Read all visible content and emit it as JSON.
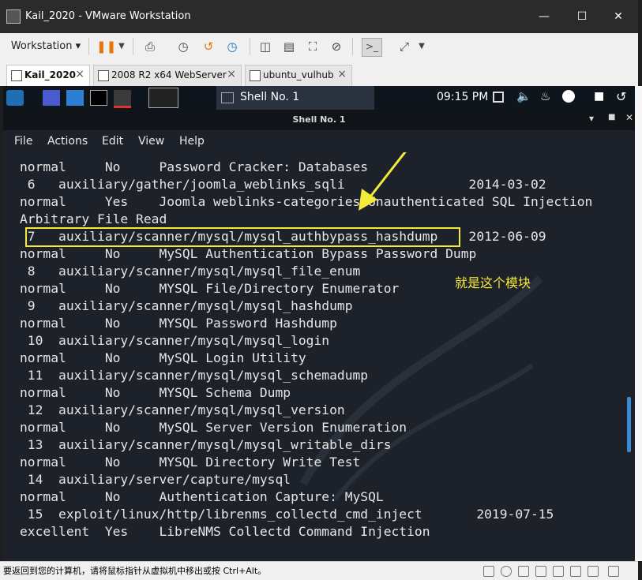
{
  "window": {
    "title": "Kail_2020 - VMware Workstation"
  },
  "toolbar": {
    "workstation_label": "Workstation"
  },
  "tabs": [
    {
      "label": "Kail_2020"
    },
    {
      "label": "2008 R2 x64 WebServer"
    },
    {
      "label": "ubuntu_vulhub"
    }
  ],
  "guest_panel": {
    "task_label": "Shell No. 1",
    "clock": "09:15 PM"
  },
  "terminal": {
    "title": "Shell No. 1",
    "menu": [
      "File",
      "Actions",
      "Edit",
      "View",
      "Help"
    ],
    "lines": [
      "normal     No     Password Cracker: Databases",
      " 6   auxiliary/gather/joomla_weblinks_sqli                2014-03-02",
      "normal     Yes    Joomla weblinks-categories Unauthenticated SQL Injection",
      "Arbitrary File Read",
      " 7   auxiliary/scanner/mysql/mysql_authbypass_hashdump    2012-06-09",
      "normal     No     MySQL Authentication Bypass Password Dump",
      " 8   auxiliary/scanner/mysql/mysql_file_enum",
      "normal     No     MYSQL File/Directory Enumerator",
      " 9   auxiliary/scanner/mysql/mysql_hashdump",
      "normal     No     MYSQL Password Hashdump",
      " 10  auxiliary/scanner/mysql/mysql_login",
      "normal     No     MySQL Login Utility",
      " 11  auxiliary/scanner/mysql/mysql_schemadump",
      "normal     No     MYSQL Schema Dump",
      " 12  auxiliary/scanner/mysql/mysql_version",
      "normal     No     MySQL Server Version Enumeration",
      " 13  auxiliary/scanner/mysql/mysql_writable_dirs",
      "normal     No     MYSQL Directory Write Test",
      " 14  auxiliary/server/capture/mysql",
      "normal     No     Authentication Capture: MySQL",
      " 15  exploit/linux/http/librenms_collectd_cmd_inject       2019-07-15",
      "excellent  Yes    LibreNMS Collectd Command Injection"
    ],
    "annotation": "就是这个模块"
  },
  "statusbar": {
    "message": "要返回到您的计算机，请将鼠标指针从虚拟机中移出或按 Ctrl+Alt。"
  },
  "colors": {
    "highlight": "#f4ea3a",
    "terminal_bg": "#1d2129"
  }
}
